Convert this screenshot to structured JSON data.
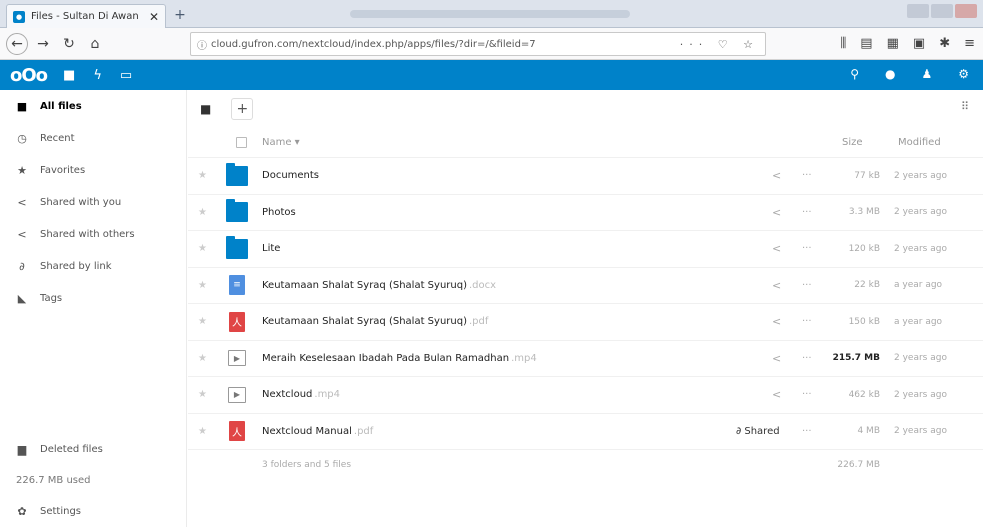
{
  "browser": {
    "tab_title": "Files - Sultan Di Awan",
    "tab_close": "✕",
    "new_tab": "+",
    "url": "cloud.gufron.com/nextcloud/index.php/apps/files/?dir=/&fileid=7",
    "url_actions": "··· ♡ ☆"
  },
  "header": {
    "logo": "oOo"
  },
  "sidebar": {
    "items": [
      {
        "label": "All files",
        "icon": "folder-icon"
      },
      {
        "label": "Recent",
        "icon": "clock-icon"
      },
      {
        "label": "Favorites",
        "icon": "star-icon"
      },
      {
        "label": "Shared with you",
        "icon": "share-icon"
      },
      {
        "label": "Shared with others",
        "icon": "share-icon"
      },
      {
        "label": "Shared by link",
        "icon": "link-icon"
      },
      {
        "label": "Tags",
        "icon": "tag-icon"
      }
    ],
    "deleted_files": "Deleted files",
    "quota": "226.7 MB used",
    "settings": "Settings"
  },
  "controls": {
    "add": "+"
  },
  "table": {
    "headers": {
      "name": "Name ▾",
      "size": "Size",
      "modified": "Modified"
    },
    "rows": [
      {
        "name": "Documents",
        "ext": "",
        "type": "folder",
        "size": "77 kB",
        "modified": "2 years ago",
        "shared": ""
      },
      {
        "name": "Photos",
        "ext": "",
        "type": "folder",
        "size": "3.3 MB",
        "modified": "2 years ago",
        "shared": ""
      },
      {
        "name": "Lite",
        "ext": "",
        "type": "folder",
        "size": "120 kB",
        "modified": "2 years ago",
        "shared": ""
      },
      {
        "name": "Keutamaan Shalat Syraq (Shalat Syuruq)",
        "ext": ".docx",
        "type": "doc",
        "size": "22 kB",
        "modified": "a year ago",
        "shared": ""
      },
      {
        "name": "Keutamaan Shalat Syraq (Shalat Syuruq)",
        "ext": ".pdf",
        "type": "pdf",
        "size": "150 kB",
        "modified": "a year ago",
        "shared": ""
      },
      {
        "name": "Meraih Keselesaan Ibadah Pada Bulan Ramadhan",
        "ext": ".mp4",
        "type": "video",
        "size": "215.7 MB",
        "modified": "2 years ago",
        "shared": ""
      },
      {
        "name": "Nextcloud",
        "ext": ".mp4",
        "type": "video",
        "size": "462 kB",
        "modified": "2 years ago",
        "shared": ""
      },
      {
        "name": "Nextcloud Manual",
        "ext": ".pdf",
        "type": "pdf",
        "size": "4 MB",
        "modified": "2 years ago",
        "shared": "Shared"
      }
    ],
    "summary_text": "3 folders and 5 files",
    "summary_size": "226.7 MB"
  }
}
